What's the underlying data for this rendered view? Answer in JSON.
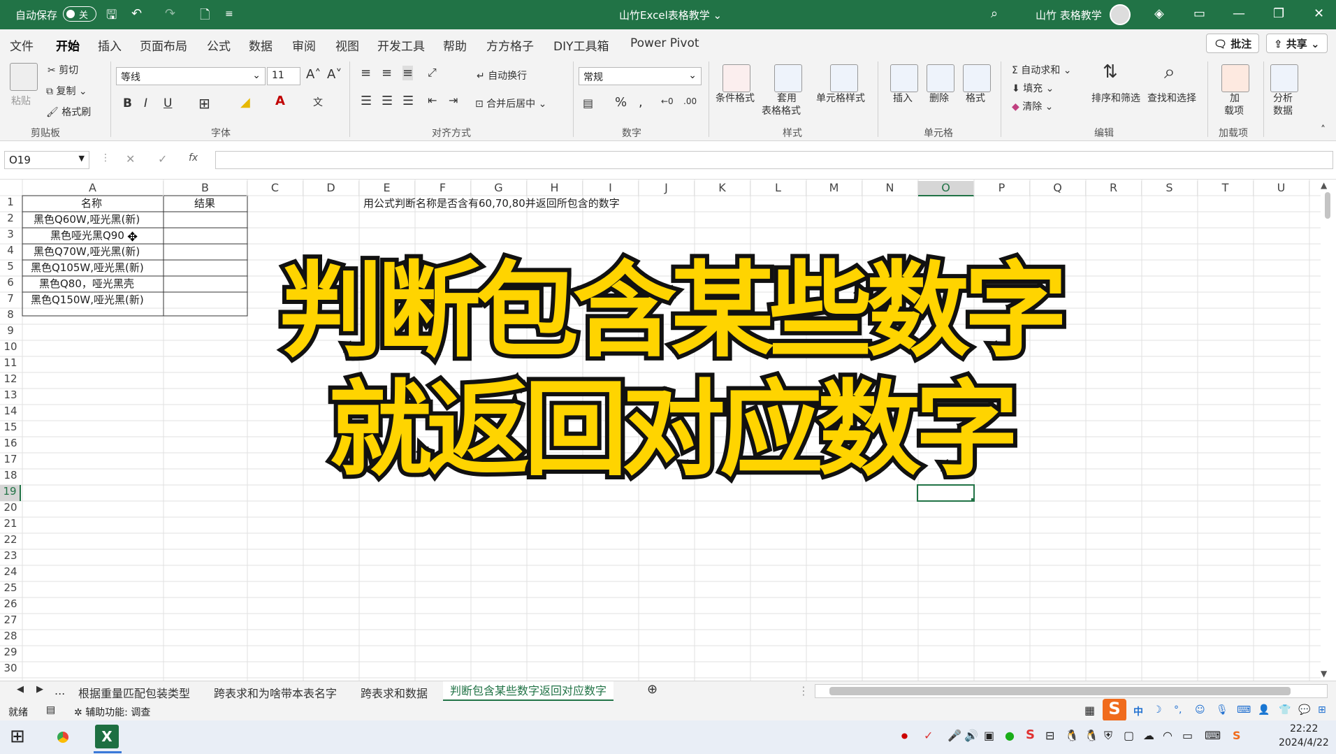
{
  "titlebar": {
    "autosave_label": "自动保存",
    "autosave_state": "关",
    "title": "山竹Excel表格教学 ⌄",
    "user": "山竹 表格教学"
  },
  "menubar": {
    "items": [
      "文件",
      "开始",
      "插入",
      "页面布局",
      "公式",
      "数据",
      "审阅",
      "视图",
      "开发工具",
      "帮助",
      "方方格子",
      "DIY工具箱",
      "Power Pivot"
    ],
    "comment_btn": "批注",
    "share_btn": "共享"
  },
  "ribbon": {
    "clipboard": {
      "paste": "粘贴",
      "cut": "剪切",
      "copy": "复制",
      "format_painter": "格式刷",
      "group": "剪贴板"
    },
    "font": {
      "name": "等线",
      "size": "11",
      "group": "字体",
      "bold": "B",
      "italic": "I",
      "underline": "U"
    },
    "align": {
      "wrap": "自动换行",
      "merge": "合并后居中",
      "group": "对齐方式"
    },
    "number": {
      "format": "常规",
      "group": "数字"
    },
    "styles": {
      "cond": "条件格式",
      "table_1": "套用",
      "table_2": "表格格式",
      "cell": "单元格样式",
      "group": "样式"
    },
    "cells": {
      "insert": "插入",
      "delete": "删除",
      "format": "格式",
      "group": "单元格"
    },
    "edit": {
      "autosum": "自动求和",
      "fill": "填充",
      "clear": "清除",
      "sort": "排序和筛选",
      "find": "查找和选择",
      "group": "编辑"
    },
    "addins": {
      "label_1": "加",
      "label_2": "载项",
      "group": "加载项"
    },
    "analysis": {
      "label_1": "分析",
      "label_2": "数据"
    }
  },
  "formula": {
    "namebox": "O19",
    "fx": "fx"
  },
  "columns": [
    "A",
    "B",
    "C",
    "D",
    "E",
    "F",
    "G",
    "H",
    "I",
    "J",
    "K",
    "L",
    "M",
    "N",
    "O",
    "P",
    "Q",
    "R",
    "S",
    "T",
    "U"
  ],
  "rows": [
    "1",
    "2",
    "3",
    "4",
    "5",
    "6",
    "7",
    "8",
    "9",
    "10",
    "11",
    "12",
    "13",
    "14",
    "15",
    "16",
    "17",
    "18",
    "19",
    "20",
    "21",
    "22",
    "23",
    "24",
    "25",
    "26",
    "27",
    "28",
    "29",
    "30"
  ],
  "cells": {
    "a1": "名称",
    "b1": "结果",
    "a2": "黑色Q60W,哑光黑(新)",
    "a3": "黑色哑光黑Q90",
    "a4": "黑色Q70W,哑光黑(新)",
    "a5": "黑色Q105W,哑光黑(新)",
    "a6": "黑色Q80，哑光黑壳",
    "a7": "黑色Q150W,哑光黑(新)",
    "e1": "用公式判断名称是否含有60,70,80并返回所包含的数字"
  },
  "overlay": {
    "line1": "判断包含某些数字",
    "line2": "就返回对应数字"
  },
  "tabs": {
    "more": "...",
    "t1": "根据重量匹配包装类型",
    "t2": "跨表求和为啥带本表名字",
    "t3": "跨表求和数据",
    "t4": "判断包含某些数字返回对应数字"
  },
  "status": {
    "ready": "就绪",
    "access": "辅助功能: 调查"
  },
  "taskbar": {
    "time": "22:22",
    "date": "2024/4/22"
  },
  "colors": {
    "accent": "#217346",
    "overlay_fill": "#ffd400"
  }
}
